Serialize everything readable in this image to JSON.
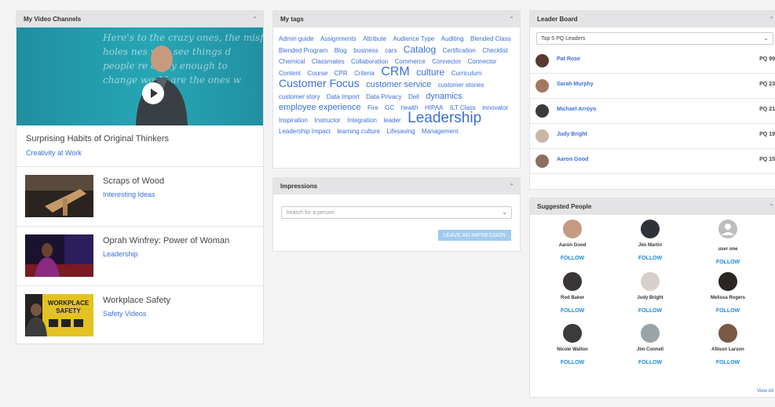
{
  "video_channels": {
    "title": "My Video Channels",
    "hero_quote": [
      "Here's to the crazy ones, the misfits",
      "holes      nes who see things d",
      "people   re crazy enough to",
      "change   world are the ones w"
    ],
    "featured": {
      "title": "Surprising Habits of Original Thinkers",
      "channel": "Creativity at Work"
    },
    "videos": [
      {
        "title": "Scraps of Wood",
        "channel": "Interesting Ideas"
      },
      {
        "title": "Oprah Winfrey: Power of Woman",
        "channel": "Leadership"
      },
      {
        "title": "Workplace Safety",
        "channel": "Safety Videos",
        "thumb_text": "WORKPLACE SAFETY"
      }
    ]
  },
  "tags": {
    "title": "My tags",
    "items": [
      {
        "t": "Admin guide",
        "s": 8
      },
      {
        "t": "Assignments",
        "s": 8
      },
      {
        "t": "Attribute",
        "s": 8
      },
      {
        "t": "Audience Type",
        "s": 8
      },
      {
        "t": "Auditing",
        "s": 8
      },
      {
        "t": "Blended Class",
        "s": 8
      },
      {
        "t": "Blended Program",
        "s": 8
      },
      {
        "t": "Blog",
        "s": 8
      },
      {
        "t": "business",
        "s": 8
      },
      {
        "t": "cars",
        "s": 8
      },
      {
        "t": "Catalog",
        "s": 12
      },
      {
        "t": "Certification",
        "s": 8
      },
      {
        "t": "Checklist",
        "s": 8
      },
      {
        "t": "Chemical",
        "s": 8
      },
      {
        "t": "Classmates",
        "s": 8
      },
      {
        "t": "Collaboration",
        "s": 8
      },
      {
        "t": "Commerce",
        "s": 8
      },
      {
        "t": "Connector",
        "s": 8
      },
      {
        "t": "Connector",
        "s": 8
      },
      {
        "t": "Content",
        "s": 8
      },
      {
        "t": "Course",
        "s": 8
      },
      {
        "t": "CPR",
        "s": 8
      },
      {
        "t": "Criteria",
        "s": 8
      },
      {
        "t": "CRM",
        "s": 16
      },
      {
        "t": "culture",
        "s": 12
      },
      {
        "t": "Curriculum",
        "s": 8
      },
      {
        "t": "Customer Focus",
        "s": 14
      },
      {
        "t": "customer service",
        "s": 11
      },
      {
        "t": "customer stories",
        "s": 8
      },
      {
        "t": "customer story",
        "s": 8
      },
      {
        "t": "Data Import",
        "s": 8
      },
      {
        "t": "Data Privacy",
        "s": 8
      },
      {
        "t": "Dell",
        "s": 8
      },
      {
        "t": "dynamics",
        "s": 11
      },
      {
        "t": "employee experience",
        "s": 11
      },
      {
        "t": "Fire",
        "s": 8
      },
      {
        "t": "GC",
        "s": 8
      },
      {
        "t": "health",
        "s": 8
      },
      {
        "t": "HIPAA",
        "s": 8
      },
      {
        "t": "ILT Class",
        "s": 8
      },
      {
        "t": "innovator",
        "s": 8
      },
      {
        "t": "Inspiration",
        "s": 8
      },
      {
        "t": "Instructor",
        "s": 8
      },
      {
        "t": "Integration",
        "s": 8
      },
      {
        "t": "leader",
        "s": 8
      },
      {
        "t": "Leadership",
        "s": 19
      },
      {
        "t": "Leadership Impact",
        "s": 8
      },
      {
        "t": "learning culture",
        "s": 8
      },
      {
        "t": "Lifesaving",
        "s": 8
      },
      {
        "t": "Management",
        "s": 8
      }
    ]
  },
  "impressions": {
    "title": "Impressions",
    "search_placeholder": "Search for a person",
    "button_label": "LEAVE AN IMPRESSION"
  },
  "leaderboard": {
    "title": "Leader Board",
    "selector": "Top 5 PQ Leaders",
    "leaders": [
      {
        "name": "Pat Rose",
        "score": "PQ 99"
      },
      {
        "name": "Sarah Murphy",
        "score": "PQ 23"
      },
      {
        "name": "Michael Arroyo",
        "score": "PQ 21"
      },
      {
        "name": "Judy Bright",
        "score": "PQ 19"
      },
      {
        "name": "Aaron Good",
        "score": "PQ 15"
      }
    ]
  },
  "suggested_people": {
    "title": "Suggested People",
    "follow_label": "FOLLOW",
    "view_all": "View All",
    "people": [
      {
        "name": "Aaron Good"
      },
      {
        "name": "Jim Martin"
      },
      {
        "name": "user one"
      },
      {
        "name": "Rod Baker"
      },
      {
        "name": "Judy Bright"
      },
      {
        "name": "Melissa Rogers"
      },
      {
        "name": "Nicole Walton"
      },
      {
        "name": "Jim Connell"
      },
      {
        "name": "Allison Larson"
      }
    ]
  }
}
